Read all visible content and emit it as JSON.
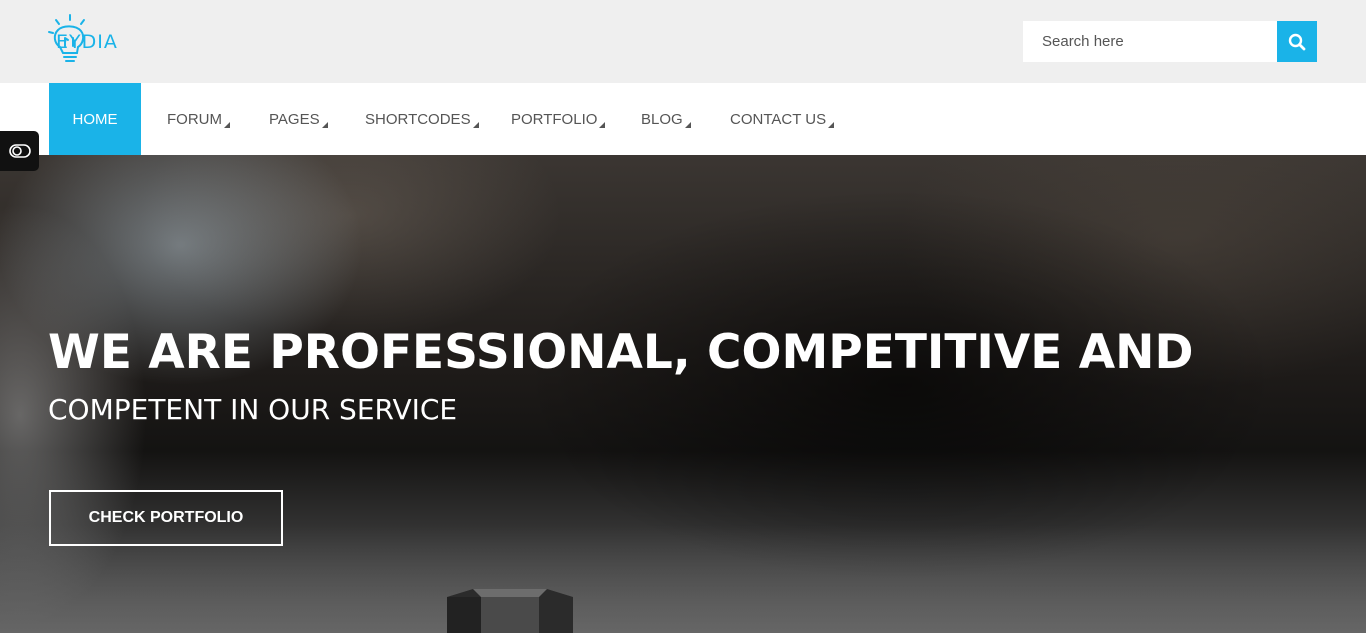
{
  "header": {
    "logo_text": "EYDIA",
    "search": {
      "placeholder": "Search here",
      "icon": "search-icon"
    }
  },
  "nav": {
    "items": [
      {
        "label": "HOME",
        "active": true,
        "has_submenu": false
      },
      {
        "label": "FORUM",
        "active": false,
        "has_submenu": true
      },
      {
        "label": "PAGES",
        "active": false,
        "has_submenu": true
      },
      {
        "label": "SHORTCODES",
        "active": false,
        "has_submenu": true
      },
      {
        "label": "PORTFOLIO",
        "active": false,
        "has_submenu": true
      },
      {
        "label": "BLOG",
        "active": false,
        "has_submenu": true
      },
      {
        "label": "CONTACT US",
        "active": false,
        "has_submenu": true
      }
    ]
  },
  "side_toggle": {
    "icon": "toggle-icon"
  },
  "hero": {
    "title": "WE ARE PROFESSIONAL, COMPETITIVE AND",
    "subtitle": "COMPETENT IN OUR SERVICE",
    "button_label": "CHECK PORTFOLIO"
  },
  "colors": {
    "accent": "#1ab3e8",
    "header_bg": "#efefef",
    "nav_bg": "#ffffff",
    "nav_text": "#555555"
  }
}
